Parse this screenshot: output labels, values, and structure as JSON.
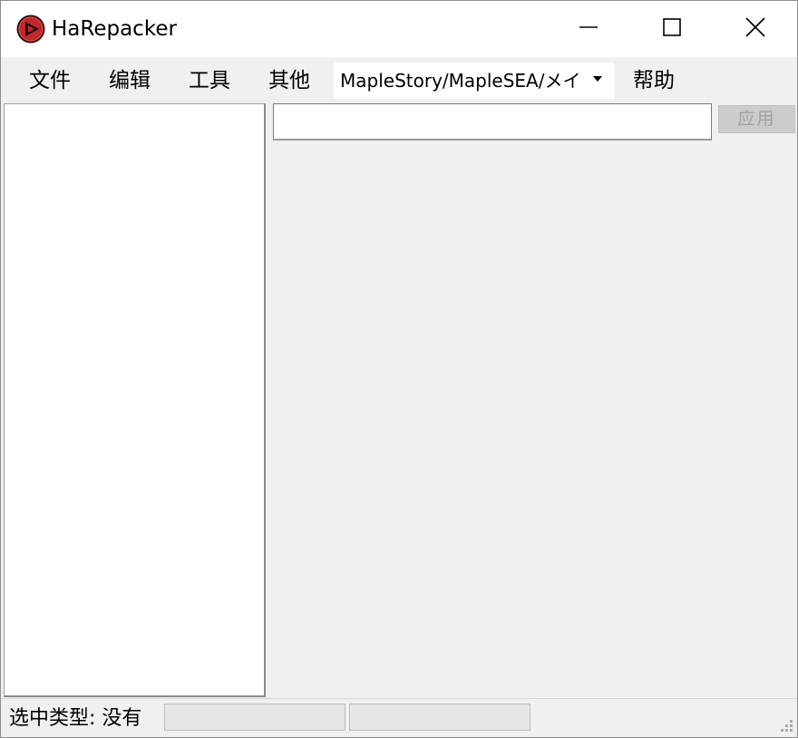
{
  "window": {
    "title": "HaRepacker",
    "icon": "harepacker-logo-icon",
    "controls": [
      "minimize-icon",
      "maximize-icon",
      "close-icon"
    ]
  },
  "menu": {
    "file": "文件",
    "edit": "编辑",
    "tools": "工具",
    "other": "其他",
    "help": "帮助"
  },
  "encryption_select": {
    "selected": "MapleStory/MapleSEA/メイ"
  },
  "property_editor": {
    "value": "",
    "apply_label": "应用"
  },
  "status": {
    "selection_type_label": "选中类型: 没有",
    "field1": "",
    "field2": ""
  },
  "colors": {
    "window_bg": "#f0f0f0",
    "titlebar_bg": "#ffffff",
    "logo_red": "#c0282e",
    "logo_dark": "#3a1010"
  }
}
